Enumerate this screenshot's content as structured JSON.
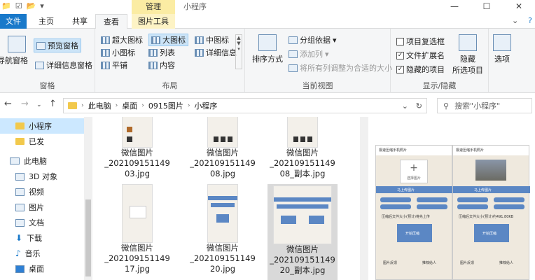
{
  "window": {
    "title": "小程序",
    "context_tab": "管理"
  },
  "tabs": [
    "文件",
    "主页",
    "共享",
    "查看",
    "图片工具"
  ],
  "ribbon": {
    "panes": {
      "label": "窗格",
      "nav_pane": "导航窗格",
      "preview_pane": "预览窗格",
      "details_pane": "详细信息窗格"
    },
    "layout": {
      "label": "布局",
      "items": [
        "超大图标",
        "大图标",
        "中图标",
        "小图标",
        "列表",
        "详细信息",
        "平铺",
        "内容"
      ]
    },
    "current_view": {
      "label": "当前视图",
      "sort": "排序方式",
      "group": "分组依据",
      "add_column": "添加列",
      "fit_columns": "将所有列调整为合适的大小"
    },
    "show_hide": {
      "label": "显示/隐藏",
      "checkboxes": [
        "项目复选框",
        "文件扩展名",
        "隐藏的项目"
      ],
      "hide_selected": "隐藏\n所选项目",
      "options": "选项"
    }
  },
  "address": {
    "crumbs": [
      "此电脑",
      "桌面",
      "0915图片",
      "小程序"
    ],
    "search_placeholder": "搜索\"小程序\""
  },
  "nav": [
    "小程序",
    "已发",
    "此电脑",
    "3D 对象",
    "视频",
    "图片",
    "文档",
    "下载",
    "音乐",
    "桌面"
  ],
  "files": [
    {
      "line1": "微信图片",
      "line2": "_202109151149",
      "line3": "03.jpg"
    },
    {
      "line1": "微信图片",
      "line2": "_202109151149",
      "line3": "08.jpg"
    },
    {
      "line1": "微信图片",
      "line2": "_202109151149",
      "line3": "08_副本.jpg"
    },
    {
      "line1": "微信图片",
      "line2": "_202109151149",
      "line3": "17.jpg"
    },
    {
      "line1": "微信图片",
      "line2": "_202109151149",
      "line3": "20.jpg"
    },
    {
      "line1": "微信图片",
      "line2": "_202109151149",
      "line3": "20_副本.jpg"
    }
  ],
  "preview": {
    "left": {
      "title": "极速压缩手机照片",
      "upload": "选择图片",
      "bar": "马上传图片",
      "result": "压缩后文件大小(预计)将先上传",
      "button": "开始压缩",
      "f1": "图片反馈",
      "f2": "推荐给人"
    },
    "right": {
      "title": "极速压缩手机照片",
      "bar": "马上传图片",
      "result": "压缩后文件大小(预计)约491.80KB",
      "button": "开始压缩",
      "f1": "图片反馈",
      "f2": "推荐给人"
    }
  }
}
